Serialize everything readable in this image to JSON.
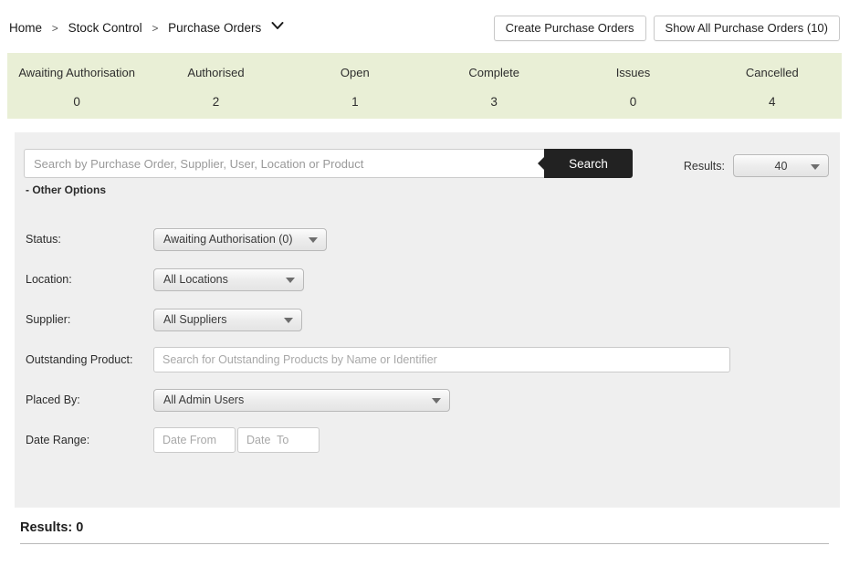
{
  "breadcrumb": {
    "items": [
      "Home",
      "Stock Control",
      "Purchase Orders"
    ],
    "separator": ">",
    "chevron_icon": "chevron-down-icon"
  },
  "header_actions": {
    "create_label": "Create Purchase Orders",
    "show_all_label": "Show All Purchase Orders (10)"
  },
  "status_bar": {
    "background": "#e9efd6",
    "columns": [
      {
        "label": "Awaiting Authorisation",
        "value": "0"
      },
      {
        "label": "Authorised",
        "value": "2"
      },
      {
        "label": "Open",
        "value": "1"
      },
      {
        "label": "Complete",
        "value": "3"
      },
      {
        "label": "Issues",
        "value": "0"
      },
      {
        "label": "Cancelled",
        "value": "4"
      }
    ]
  },
  "search": {
    "placeholder": "Search by Purchase Order, Supplier, User, Location or Product",
    "value": "",
    "button_label": "Search",
    "button_color": "#222222"
  },
  "results_selector": {
    "label": "Results:",
    "value": "40"
  },
  "other_options_toggle": "- Other Options",
  "filters": {
    "status": {
      "label": "Status:",
      "value": "Awaiting Authorisation (0)"
    },
    "location": {
      "label": "Location:",
      "value": "All Locations"
    },
    "supplier": {
      "label": "Supplier:",
      "value": "All Suppliers"
    },
    "outstanding_product": {
      "label": "Outstanding Product:",
      "placeholder": "Search for Outstanding Products by Name or Identifier",
      "value": ""
    },
    "placed_by": {
      "label": "Placed By:",
      "value": "All Admin Users"
    },
    "date_range": {
      "label": "Date Range:",
      "from_placeholder": "Date From",
      "to_placeholder": "Date  To",
      "from_value": "",
      "to_value": ""
    }
  },
  "results_footer": {
    "title": "Results: 0"
  }
}
